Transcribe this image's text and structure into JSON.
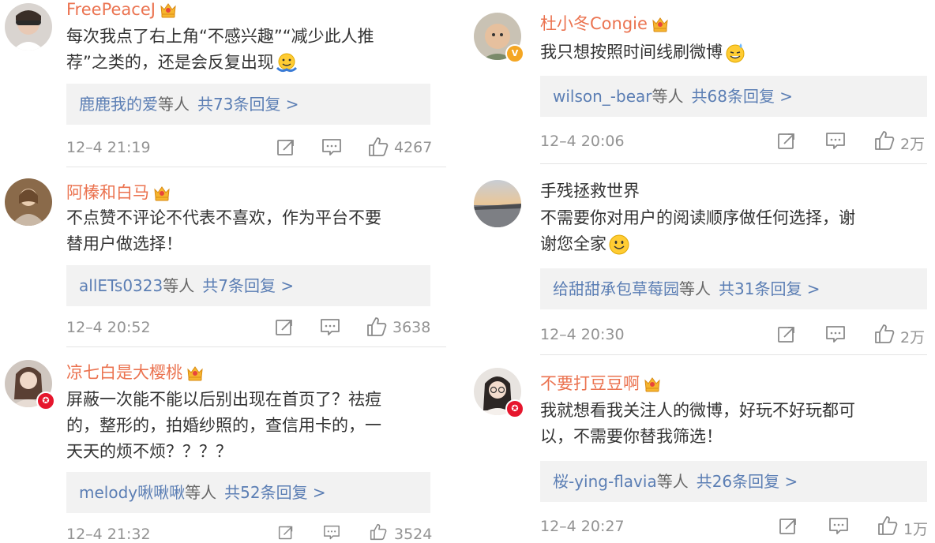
{
  "left": [
    {
      "username": "FreePeaceJ",
      "text_lines": [
        "每次我点了右上角“不感兴趣”“减少此人推",
        "荐”之类的，还是会反复出现"
      ],
      "reply_names": "鹿鹿我的爱",
      "reply_suffix": "等人",
      "reply_count": "共73条回复 >",
      "time": "12–4 21:19",
      "likes": "4267"
    },
    {
      "username": "阿榛和白马",
      "text_lines": [
        "不点赞不评论不代表不喜欢，作为平台不要",
        "替用户做选择！"
      ],
      "reply_names": "allETs0323",
      "reply_suffix": "等人",
      "reply_count": "共7条回复 >",
      "time": "12–4 20:52",
      "likes": "3638"
    },
    {
      "username": "凉七白是大樱桃",
      "text_lines": [
        "屏蔽一次能不能以后别出现在首页了？祛痘",
        "的，整形的，拍婚纱照的，查信用卡的，一",
        "天天的烦不烦？？？？"
      ],
      "reply_names": "melody啾啾啾",
      "reply_suffix": "等人",
      "reply_count": "共52条回复 >",
      "time": "12–4 21:32",
      "likes": "3524"
    }
  ],
  "right": [
    {
      "username": "杜小冬Congie",
      "text_lines": [
        "我只想按照时间线刷微博"
      ],
      "reply_names": "wilson_-bear",
      "reply_suffix": "等人",
      "reply_count": "共68条回复 >",
      "time": "12–4 20:06",
      "likes": "2万"
    },
    {
      "username": "手残拯救世界",
      "text_lines": [
        "不需要你对用户的阅读顺序做任何选择，谢",
        "谢您全家"
      ],
      "reply_names": "给甜甜承包草莓园",
      "reply_suffix": "等人",
      "reply_count": "共31条回复 >",
      "time": "12–4 20:30",
      "likes": "2万"
    },
    {
      "username": "不要打豆豆啊",
      "text_lines": [
        "我就想看我关注人的微博，好玩不好玩都可",
        "以，不需要你替我筛选！"
      ],
      "reply_names": "桜-ying-flavia",
      "reply_suffix": "等人",
      "reply_count": "共26条回复 >",
      "time": "12–4 20:27",
      "likes": "1万"
    }
  ],
  "colors": {
    "username": "#eb7350",
    "link": "#5b7eb4",
    "meta": "#939393",
    "reply_bg": "#f2f2f2"
  },
  "icons": {
    "crown": "vip-crown-icon",
    "share": "share-icon",
    "comment": "comment-icon",
    "like": "thumbs-up-icon",
    "verified_gold": "verified-gold-icon",
    "verified_red": "verified-red-icon"
  }
}
